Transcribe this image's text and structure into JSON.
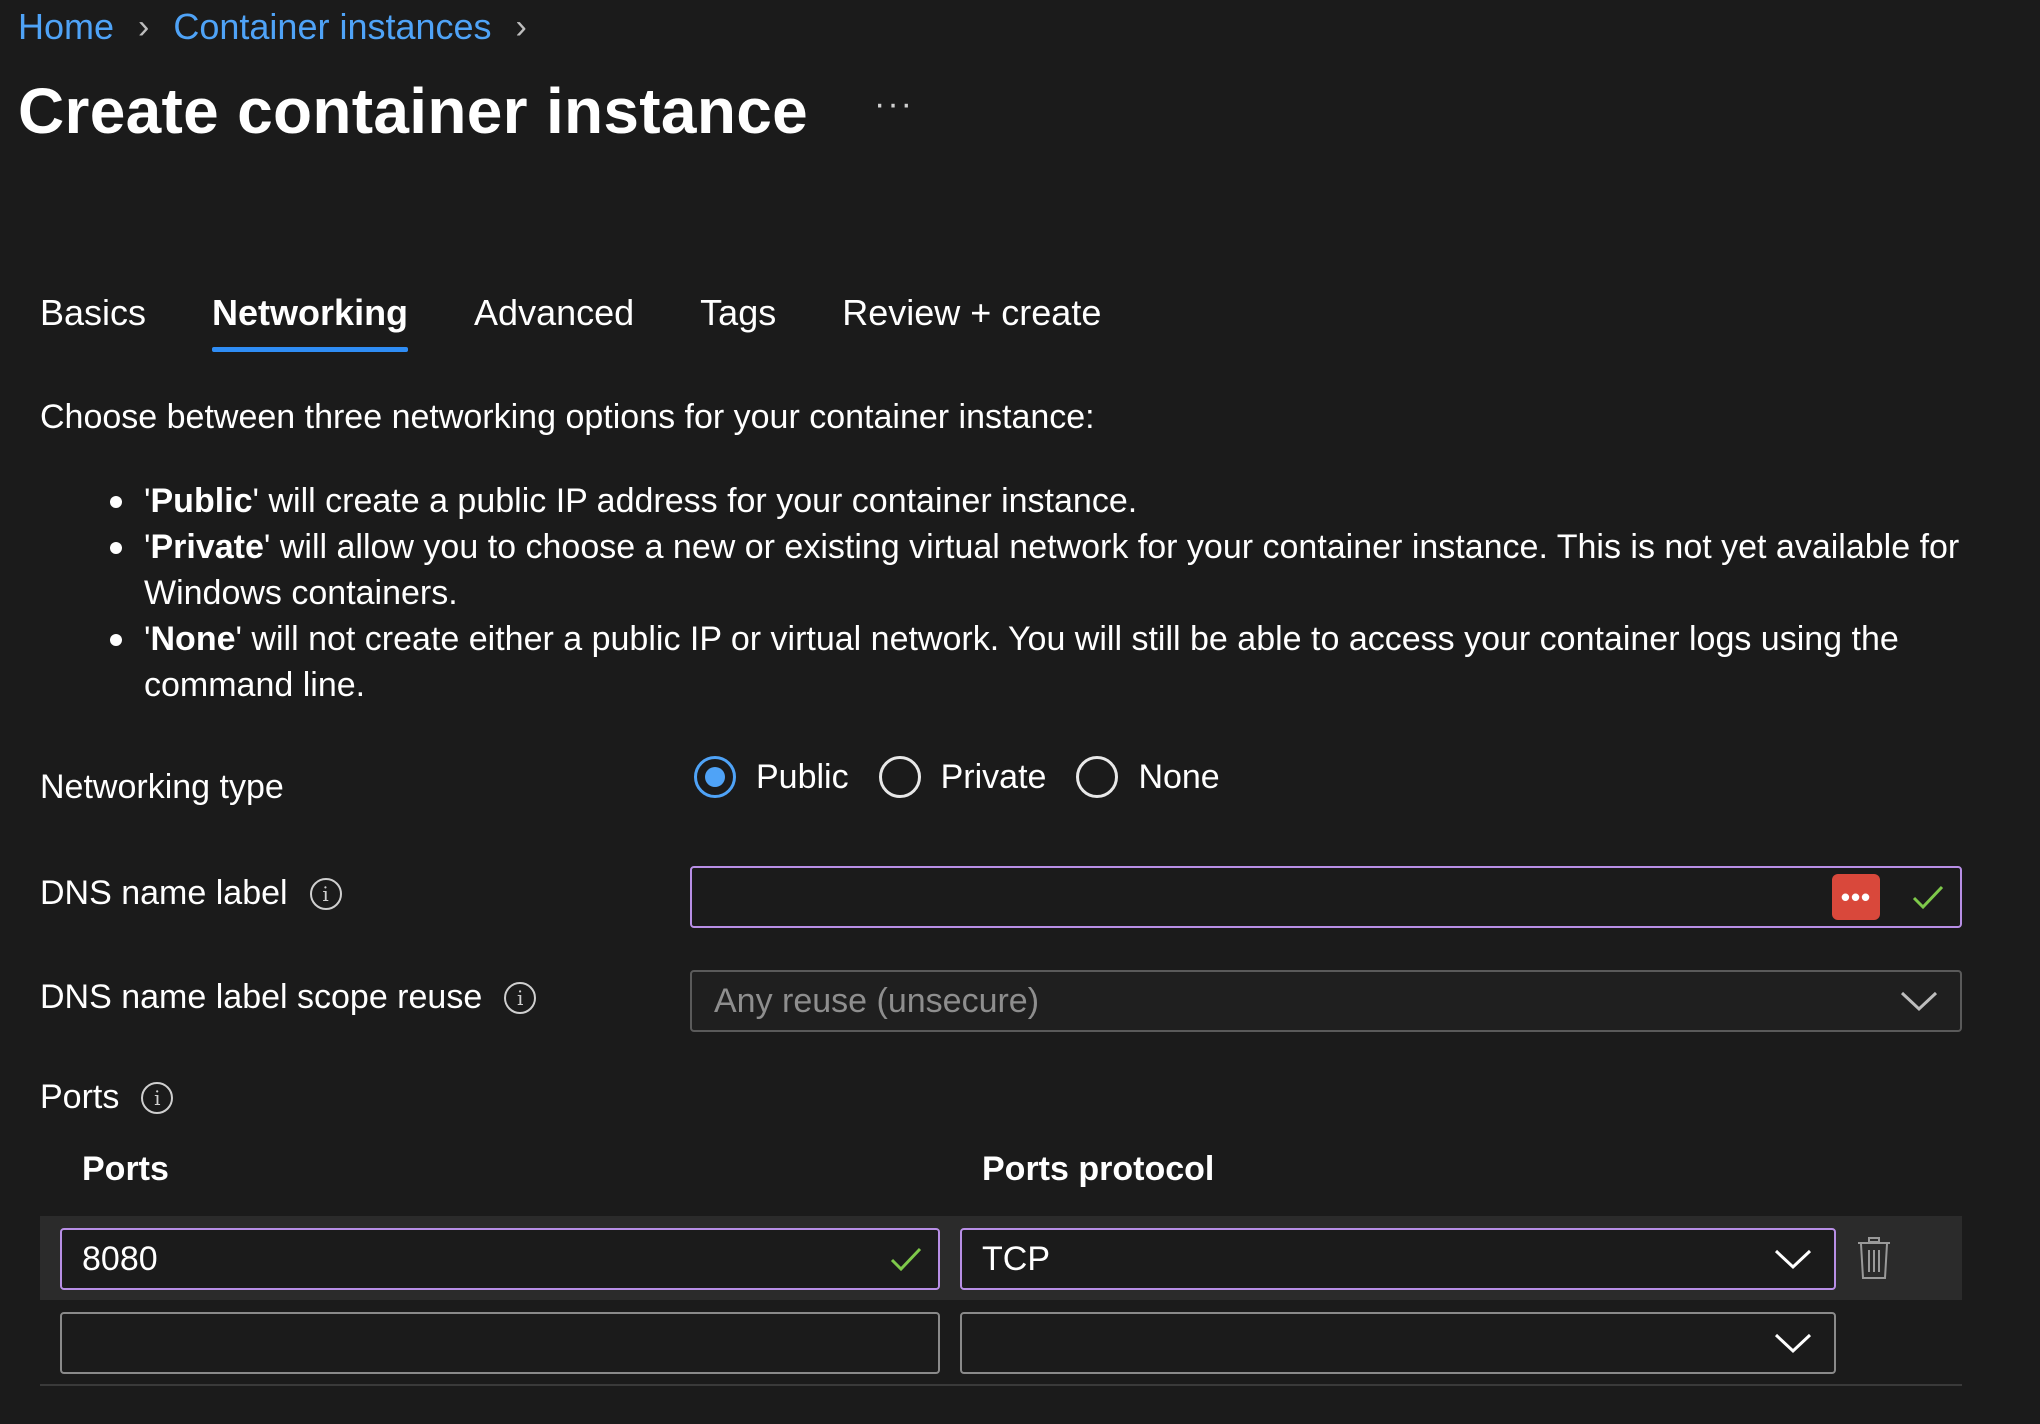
{
  "breadcrumb": {
    "items": [
      "Home",
      "Container instances"
    ],
    "separator": ">"
  },
  "page": {
    "title": "Create container instance",
    "more_label": "···"
  },
  "tabs": [
    {
      "label": "Basics",
      "active": false
    },
    {
      "label": "Networking",
      "active": true
    },
    {
      "label": "Advanced",
      "active": false
    },
    {
      "label": "Tags",
      "active": false
    },
    {
      "label": "Review + create",
      "active": false
    }
  ],
  "intro": "Choose between three networking options for your container instance:",
  "bullets": [
    {
      "quote_open": "'",
      "bold": "Public",
      "text": "' will create a public IP address for your container instance."
    },
    {
      "quote_open": "'",
      "bold": "Private",
      "text": "' will allow you to choose a new or existing virtual network for your container instance. This is not yet available for Windows containers."
    },
    {
      "quote_open": "'",
      "bold": "None",
      "text": "' will not create either a public IP or virtual network. You will still be able to access your container logs using the command line."
    }
  ],
  "networking_type": {
    "label": "Networking type",
    "options": [
      {
        "label": "Public",
        "checked": true
      },
      {
        "label": "Private",
        "checked": false
      },
      {
        "label": "None",
        "checked": false
      }
    ]
  },
  "dns_name_label": {
    "label": "DNS name label",
    "value": "",
    "password_badge": "•••",
    "info_icon": "i"
  },
  "dns_scope_reuse": {
    "label": "DNS name label scope reuse",
    "value": "Any reuse (unsecure)",
    "info_icon": "i"
  },
  "ports": {
    "section_label": "Ports",
    "info_icon": "i",
    "col_ports": "Ports",
    "col_protocol": "Ports protocol",
    "rows": [
      {
        "port": "8080",
        "protocol": "TCP"
      },
      {
        "port": "",
        "protocol": ""
      }
    ]
  },
  "colors": {
    "background": "#1b1b1b",
    "link": "#4fa3f7",
    "accent": "#2f8df5",
    "focus_border": "#b88fe6",
    "valid_check": "#7ec94a",
    "password_badge": "#d9483b"
  }
}
